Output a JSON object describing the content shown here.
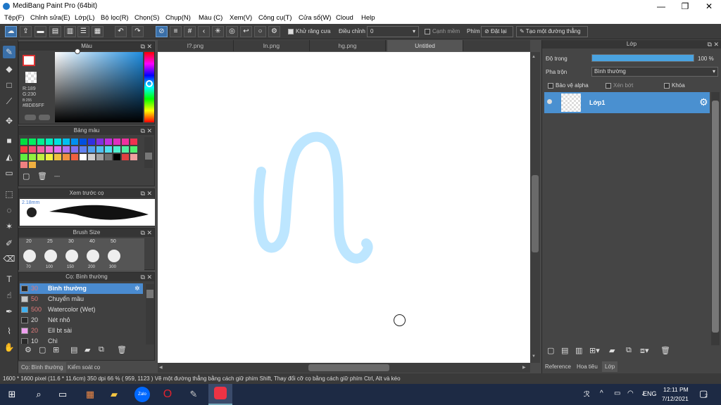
{
  "window": {
    "title": "MediBang Paint Pro (64bit)",
    "minimize": "—",
    "maximize": "❐",
    "close": "✕"
  },
  "menu": [
    "Tệp(F)",
    "Chỉnh sửa(E)",
    "Lớp(L)",
    "Bộ lọc(R)",
    "Chọn(S)",
    "Chụp(N)",
    "Màu (C)",
    "Xem(V)",
    "Công cụ(T)",
    "Cửa sổ(W)",
    "Cloud",
    "Help"
  ],
  "toolbar": {
    "antialias_label": "Khử răng cưa",
    "adjust_label": "Điều chỉnh",
    "adjust_value": "0",
    "edge_label": "Cạnh mềm",
    "key_label": "Phím",
    "reset_label": "Đặt lại",
    "straight_line_label": "Tạo một đường thẳng"
  },
  "color_panel": {
    "title": "Màu",
    "r": "R:189",
    "g": "G:230",
    "b": "B:255",
    "hex": "#BDE6FF"
  },
  "palette_panel": {
    "title": "Bảng màu",
    "dash": "---",
    "colors": [
      "#00e040",
      "#00f060",
      "#00f090",
      "#00f0c0",
      "#00e0e0",
      "#00c0f0",
      "#0090f0",
      "#0050e0",
      "#3030e0",
      "#8030e0",
      "#c030e0",
      "#e030c0",
      "#f030a0",
      "#f03050",
      "#f04040",
      "#f05070",
      "#f060a0",
      "#f070d0",
      "#e070f0",
      "#b070f0",
      "#8070f0",
      "#6080f0",
      "#50a0f0",
      "#50c0f0",
      "#50e0f0",
      "#50f0d0",
      "#50f0a0",
      "#50f070",
      "#60f040",
      "#90f040",
      "#c0f040",
      "#f0f040",
      "#f0c040",
      "#f09040",
      "#f06040",
      "#ffffff",
      "#d0d0d0",
      "#a0a0a0",
      "#707070",
      "#000000",
      "#e04040",
      "#f0a0a0",
      "#f08080",
      "#f0b040"
    ]
  },
  "preview_panel": {
    "title": "Xem trước cọ",
    "size_label": "2.18mm"
  },
  "brush_size_panel": {
    "title": "Brush Size",
    "top_labels": [
      "20",
      "25",
      "30",
      "40",
      "50"
    ],
    "bottom_labels": [
      "70",
      "100",
      "150",
      "200",
      "300"
    ]
  },
  "brush_panel": {
    "title": "Cọ: Bình thường",
    "items": [
      {
        "size": "30",
        "label": "Bình thường",
        "color": "#2a2a2a"
      },
      {
        "size": "50",
        "label": "Chuyển mầu",
        "color": "#c8c8c8"
      },
      {
        "size": "500",
        "label": "Watercolor (Wet)",
        "color": "#3fb0f0"
      },
      {
        "size": "20",
        "label": "Nét nhỏ",
        "color": "#2a2a2a"
      },
      {
        "size": "20",
        "label": "Ell bt sài",
        "color": "#f0a0f0"
      },
      {
        "size": "10",
        "label": "Chì",
        "color": "#2a2a2a"
      }
    ]
  },
  "bottom_tabs_left": [
    "Cọ: Bình thường",
    "Kiểm soát cọ"
  ],
  "canvas_tabs": [
    "l?.png",
    "ln.png",
    "hg.png",
    "Untitled"
  ],
  "layer_panel": {
    "title": "Lớp",
    "opacity_label": "Độ trong",
    "opacity_value": "100 %",
    "opacity": 1.0,
    "blend_label": "Pha trộn",
    "blend_value": "Bình thường",
    "protect_alpha": "Bảo vệ alpha",
    "clipping": "Xén bớt",
    "lock": "Khóa",
    "layer_name": "Lớp1"
  },
  "bottom_tabs_right": [
    "Reference",
    "Hoa tiêu",
    "Lớp"
  ],
  "status": "1600 * 1600 pixel   (11.6 * 11.6cm)   350 dpi   66 %   ( 959, 1123 )   Vẽ một đường thẳng bằng cách giữ phím Shift, Thay đổi cỡ cọ bằng cách giữ phím Ctrl, Alt và kéo",
  "taskbar": {
    "time": "12:11 PM",
    "date": "7/12/2021",
    "lang": "ENG",
    "notif": "2"
  },
  "stroke_color": "#BDE6FF",
  "accent": "#3a7fc8"
}
